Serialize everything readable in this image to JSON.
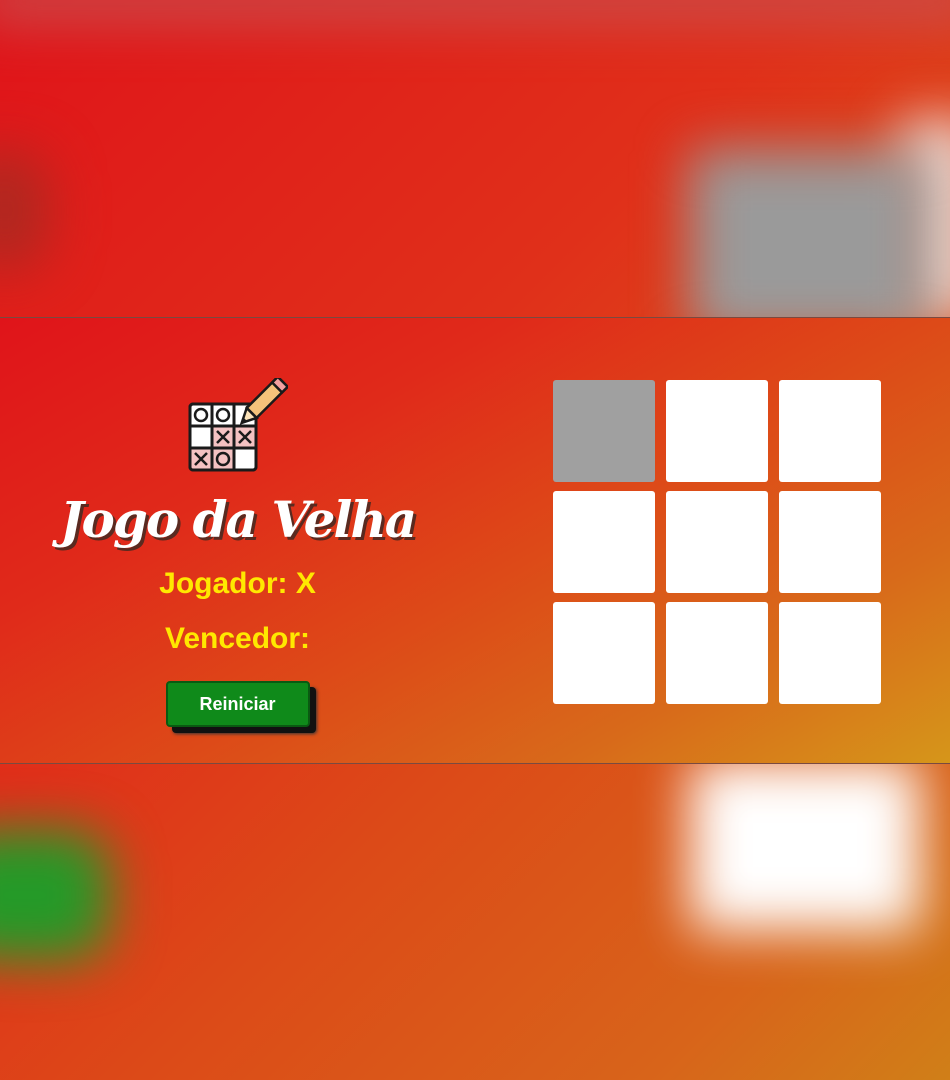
{
  "game": {
    "title": "Jogo da Velha",
    "player_label": "Jogador: X",
    "winner_label": "Vencedor:",
    "restart_label": "Reiniciar"
  },
  "logo": {
    "icon": "tic-tac-toe-pencil-icon"
  },
  "board": {
    "cells": [
      "",
      "",
      "",
      "",
      "",
      "",
      "",
      "",
      ""
    ],
    "highlighted_cell": 0
  },
  "colors": {
    "status_text": "#ffe800",
    "restart_button": "#0f8a1a",
    "cell": "#ffffff",
    "cell_highlight": "#a0a0a0"
  }
}
